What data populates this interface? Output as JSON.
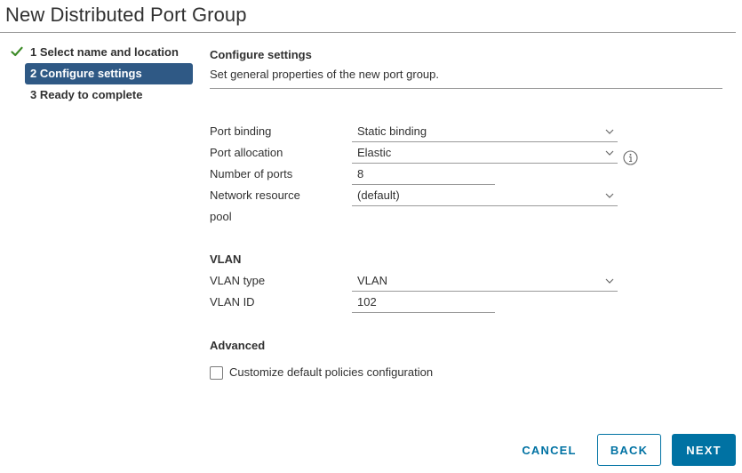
{
  "window": {
    "title": "New Distributed Port Group"
  },
  "steps": [
    {
      "label": "1 Select name and location",
      "status": "completed"
    },
    {
      "label": "2 Configure settings",
      "status": "active"
    },
    {
      "label": "3 Ready to complete",
      "status": "pending"
    }
  ],
  "main": {
    "heading": "Configure settings",
    "description": "Set general properties of the new port group.",
    "port_binding": {
      "label": "Port binding",
      "value": "Static binding"
    },
    "port_allocation": {
      "label": "Port allocation",
      "value": "Elastic"
    },
    "number_of_ports": {
      "label": "Number of ports",
      "value": "8"
    },
    "network_resource_pool": {
      "label_line1": "Network resource",
      "label_line2": "pool",
      "value": "(default)"
    },
    "vlan": {
      "heading": "VLAN",
      "type": {
        "label": "VLAN type",
        "value": "VLAN"
      },
      "id": {
        "label": "VLAN ID",
        "value": "102"
      }
    },
    "advanced": {
      "heading": "Advanced",
      "customize_label": "Customize default policies configuration",
      "customize_checked": false
    }
  },
  "footer": {
    "cancel": "CANCEL",
    "back": "BACK",
    "next": "NEXT"
  },
  "colors": {
    "accent": "#0072a3",
    "active_step_bg": "#2f5985",
    "check": "#3c8b27"
  },
  "icons": {
    "completed_step": "checkmark-icon",
    "dropdown": "chevron-down-icon",
    "info": "info-icon"
  }
}
